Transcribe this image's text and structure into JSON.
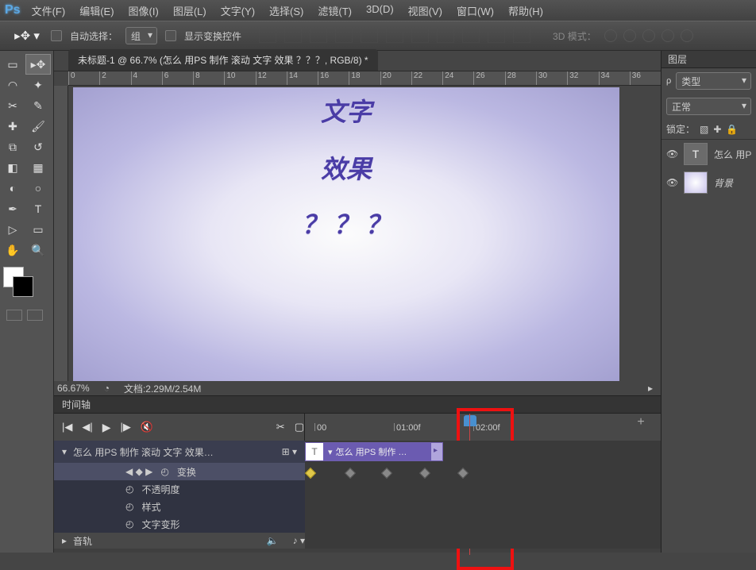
{
  "app": {
    "logo": "Ps"
  },
  "menu": [
    "文件(F)",
    "编辑(E)",
    "图像(I)",
    "图层(L)",
    "文字(Y)",
    "选择(S)",
    "滤镜(T)",
    "3D(D)",
    "视图(V)",
    "窗口(W)",
    "帮助(H)"
  ],
  "options": {
    "auto_select": "自动选择：",
    "group": "组",
    "show_transform": "显示变换控件",
    "mode3d": "3D 模式："
  },
  "document": {
    "tab": "未标题-1 @ 66.7% (怎么 用PS 制作 滚动 文字 效果 ？？？, RGB/8) *",
    "ruler_marks": [
      "0",
      "2",
      "4",
      "6",
      "8",
      "10",
      "12",
      "14",
      "16",
      "18",
      "20",
      "22",
      "24",
      "26",
      "28",
      "30",
      "32",
      "34",
      "36"
    ]
  },
  "canvas": {
    "line1": "文字",
    "line2": "效果",
    "line3": "？ ？ ？"
  },
  "status": {
    "zoom": "66.67%",
    "doc_info": "文档:2.29M/2.54M"
  },
  "timeline": {
    "tab": "时间轴",
    "time_marks": [
      "00",
      "01:00f",
      "02:00f"
    ],
    "tracks": {
      "main": "怎么 用PS 制作 滚动 文字 效果…",
      "clip": "怎么 用PS 制作 …",
      "sub": [
        "变换",
        "不透明度",
        "样式",
        "文字变形"
      ],
      "audio": "音轨"
    }
  },
  "layers": {
    "title": "图层",
    "filter": "类型",
    "blend": "正常",
    "lock": "锁定：",
    "items": [
      {
        "name": "怎么 用P",
        "kind": "T"
      },
      {
        "name": "背景",
        "kind": "bg"
      }
    ]
  },
  "chart_data": {
    "type": "timeline",
    "playhead_frame": "02:00f",
    "tracks": [
      {
        "name": "怎么 用PS 制作 滚动 文字 效果",
        "clip": {
          "start": "00",
          "end": "02:00f",
          "label": "怎么 用PS 制作 …"
        },
        "properties": {
          "变换": {
            "keyframes": [
              "00",
              "00:15f",
              "01:00f",
              "01:15f",
              "02:00f"
            ]
          },
          "不透明度": {
            "keyframes": []
          },
          "样式": {
            "keyframes": []
          },
          "文字变形": {
            "keyframes": []
          }
        }
      }
    ]
  }
}
